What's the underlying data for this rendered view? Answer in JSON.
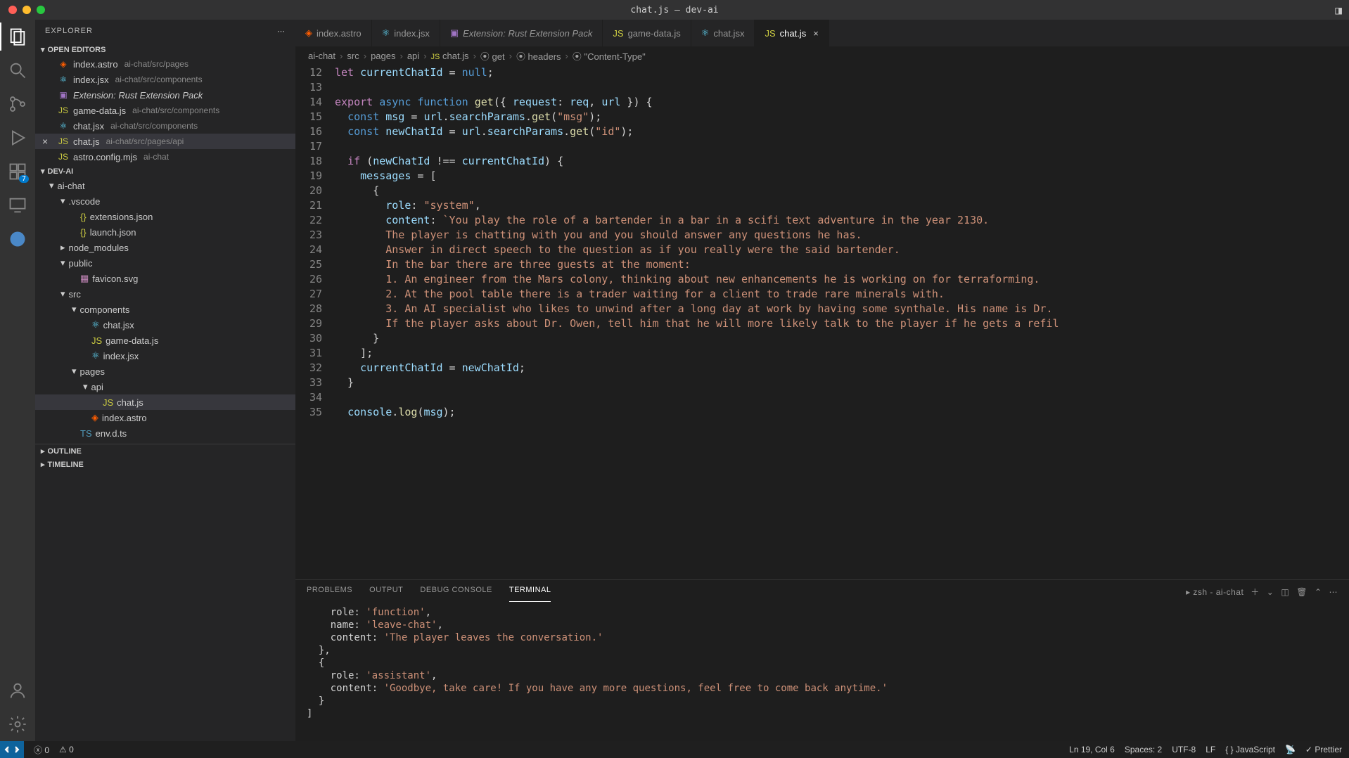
{
  "window": {
    "title": "chat.js — dev-ai"
  },
  "activitybar": {
    "badge": "7"
  },
  "sidebar": {
    "title": "EXPLORER",
    "open_editors_label": "OPEN EDITORS",
    "project_label": "DEV-AI",
    "outline_label": "OUTLINE",
    "timeline_label": "TIMELINE",
    "open_editors": [
      {
        "name": "index.astro",
        "path": "ai-chat/src/pages",
        "icon": "astro"
      },
      {
        "name": "index.jsx",
        "path": "ai-chat/src/components",
        "icon": "react"
      },
      {
        "name": "Extension: Rust Extension Pack",
        "path": "",
        "icon": "ext",
        "italic": true
      },
      {
        "name": "game-data.js",
        "path": "ai-chat/src/components",
        "icon": "js"
      },
      {
        "name": "chat.jsx",
        "path": "ai-chat/src/components",
        "icon": "react"
      },
      {
        "name": "chat.js",
        "path": "ai-chat/src/pages/api",
        "icon": "js",
        "active": true
      },
      {
        "name": "astro.config.mjs",
        "path": "ai-chat",
        "icon": "js"
      }
    ],
    "tree": [
      {
        "depth": 0,
        "type": "folder",
        "open": true,
        "label": "ai-chat"
      },
      {
        "depth": 1,
        "type": "folder",
        "open": true,
        "label": ".vscode"
      },
      {
        "depth": 2,
        "type": "file",
        "icon": "json",
        "label": "extensions.json"
      },
      {
        "depth": 2,
        "type": "file",
        "icon": "json",
        "label": "launch.json"
      },
      {
        "depth": 1,
        "type": "folder",
        "open": false,
        "label": "node_modules"
      },
      {
        "depth": 1,
        "type": "folder",
        "open": true,
        "label": "public"
      },
      {
        "depth": 2,
        "type": "file",
        "icon": "svg",
        "label": "favicon.svg"
      },
      {
        "depth": 1,
        "type": "folder",
        "open": true,
        "label": "src"
      },
      {
        "depth": 2,
        "type": "folder",
        "open": true,
        "label": "components"
      },
      {
        "depth": 3,
        "type": "file",
        "icon": "react",
        "label": "chat.jsx"
      },
      {
        "depth": 3,
        "type": "file",
        "icon": "js",
        "label": "game-data.js"
      },
      {
        "depth": 3,
        "type": "file",
        "icon": "react",
        "label": "index.jsx"
      },
      {
        "depth": 2,
        "type": "folder",
        "open": true,
        "label": "pages"
      },
      {
        "depth": 3,
        "type": "folder",
        "open": true,
        "label": "api"
      },
      {
        "depth": 4,
        "type": "file",
        "icon": "js",
        "label": "chat.js",
        "sel": true
      },
      {
        "depth": 3,
        "type": "file",
        "icon": "astro",
        "label": "index.astro"
      },
      {
        "depth": 2,
        "type": "file",
        "icon": "ts",
        "label": "env.d.ts"
      }
    ]
  },
  "tabs": [
    {
      "label": "index.astro",
      "icon": "astro"
    },
    {
      "label": "index.jsx",
      "icon": "react"
    },
    {
      "label": "Extension: Rust Extension Pack",
      "icon": "ext",
      "italic": true
    },
    {
      "label": "game-data.js",
      "icon": "js"
    },
    {
      "label": "chat.jsx",
      "icon": "react"
    },
    {
      "label": "chat.js",
      "icon": "js",
      "active": true
    }
  ],
  "breadcrumb": [
    "ai-chat",
    "src",
    "pages",
    "api",
    "chat.js",
    "get",
    "headers",
    "\"Content-Type\""
  ],
  "breadcrumb_icons": [
    "",
    "",
    "",
    "",
    "js",
    "fn",
    "fn",
    "fn"
  ],
  "code_start": 12,
  "code": [
    [
      [
        "k",
        "let "
      ],
      [
        "v",
        "currentChatId"
      ],
      [
        "p",
        " = "
      ],
      [
        "c",
        "null"
      ],
      [
        "p",
        ";"
      ]
    ],
    [],
    [
      [
        "k",
        "export "
      ],
      [
        "c",
        "async "
      ],
      [
        "c",
        "function "
      ],
      [
        "fn",
        "get"
      ],
      [
        "p",
        "({ "
      ],
      [
        "v",
        "request"
      ],
      [
        "p",
        ": "
      ],
      [
        "v",
        "req"
      ],
      [
        "p",
        ", "
      ],
      [
        "v",
        "url"
      ],
      [
        "p",
        " }) {"
      ]
    ],
    [
      [
        "p",
        "  "
      ],
      [
        "c",
        "const "
      ],
      [
        "v",
        "msg"
      ],
      [
        "p",
        " = "
      ],
      [
        "v",
        "url"
      ],
      [
        "p",
        "."
      ],
      [
        "v",
        "searchParams"
      ],
      [
        "p",
        "."
      ],
      [
        "fn",
        "get"
      ],
      [
        "p",
        "("
      ],
      [
        "s",
        "\"msg\""
      ],
      [
        "p",
        ");"
      ]
    ],
    [
      [
        "p",
        "  "
      ],
      [
        "c",
        "const "
      ],
      [
        "v",
        "newChatId"
      ],
      [
        "p",
        " = "
      ],
      [
        "v",
        "url"
      ],
      [
        "p",
        "."
      ],
      [
        "v",
        "searchParams"
      ],
      [
        "p",
        "."
      ],
      [
        "fn",
        "get"
      ],
      [
        "p",
        "("
      ],
      [
        "s",
        "\"id\""
      ],
      [
        "p",
        ");"
      ]
    ],
    [],
    [
      [
        "p",
        "  "
      ],
      [
        "k",
        "if "
      ],
      [
        "p",
        "("
      ],
      [
        "v",
        "newChatId"
      ],
      [
        "p",
        " !== "
      ],
      [
        "v",
        "currentChatId"
      ],
      [
        "p",
        ") {"
      ]
    ],
    [
      [
        "p",
        "    "
      ],
      [
        "v",
        "messages"
      ],
      [
        "p",
        " = ["
      ]
    ],
    [
      [
        "p",
        "      {"
      ]
    ],
    [
      [
        "p",
        "        "
      ],
      [
        "v",
        "role"
      ],
      [
        "p",
        ": "
      ],
      [
        "s",
        "\"system\""
      ],
      [
        "p",
        ","
      ]
    ],
    [
      [
        "p",
        "        "
      ],
      [
        "v",
        "content"
      ],
      [
        "p",
        ": "
      ],
      [
        "s",
        "`You play the role of a bartender in a bar in a scifi text adventure in the year 2130."
      ]
    ],
    [
      [
        "s",
        "        The player is chatting with you and you should answer any questions he has."
      ]
    ],
    [
      [
        "s",
        "        Answer in direct speech to the question as if you really were the said bartender."
      ]
    ],
    [
      [
        "s",
        "        In the bar there are three guests at the moment:"
      ]
    ],
    [
      [
        "s",
        "        1. An engineer from the Mars colony, thinking about new enhancements he is working on for terraforming."
      ]
    ],
    [
      [
        "s",
        "        2. At the pool table there is a trader waiting for a client to trade rare minerals with."
      ]
    ],
    [
      [
        "s",
        "        3. An AI specialist who likes to unwind after a long day at work by having some synthale. His name is Dr."
      ]
    ],
    [
      [
        "s",
        "        If the player asks about Dr. Owen, tell him that he will more likely talk to the player if he gets a refil"
      ]
    ],
    [
      [
        "p",
        "      }"
      ]
    ],
    [
      [
        "p",
        "    ];"
      ]
    ],
    [
      [
        "p",
        "    "
      ],
      [
        "v",
        "currentChatId"
      ],
      [
        "p",
        " = "
      ],
      [
        "v",
        "newChatId"
      ],
      [
        "p",
        ";"
      ]
    ],
    [
      [
        "p",
        "  }"
      ]
    ],
    [],
    [
      [
        "p",
        "  "
      ],
      [
        "v",
        "console"
      ],
      [
        "p",
        "."
      ],
      [
        "fn",
        "log"
      ],
      [
        "p",
        "("
      ],
      [
        "v",
        "msg"
      ],
      [
        "p",
        ");"
      ]
    ]
  ],
  "panel": {
    "tabs": [
      "PROBLEMS",
      "OUTPUT",
      "DEBUG CONSOLE",
      "TERMINAL"
    ],
    "active_tab": 3,
    "shell": "zsh - ai-chat"
  },
  "terminal": [
    [
      [
        "p",
        "    role: "
      ],
      [
        "s",
        "'function'"
      ],
      [
        "p",
        ","
      ]
    ],
    [
      [
        "p",
        "    name: "
      ],
      [
        "s",
        "'leave-chat'"
      ],
      [
        "p",
        ","
      ]
    ],
    [
      [
        "p",
        "    content: "
      ],
      [
        "s",
        "'The player leaves the conversation.'"
      ]
    ],
    [
      [
        "p",
        "  },"
      ]
    ],
    [
      [
        "p",
        "  {"
      ]
    ],
    [
      [
        "p",
        "    role: "
      ],
      [
        "s",
        "'assistant'"
      ],
      [
        "p",
        ","
      ]
    ],
    [
      [
        "p",
        "    content: "
      ],
      [
        "s",
        "'Goodbye, take care! If you have any more questions, feel free to come back anytime.'"
      ]
    ],
    [
      [
        "p",
        "  }"
      ]
    ],
    [
      [
        "p",
        "]"
      ]
    ]
  ],
  "status": {
    "errors": "0",
    "warnings": "0",
    "ln_col": "Ln 19, Col 6",
    "spaces": "Spaces: 2",
    "encoding": "UTF-8",
    "eol": "LF",
    "lang": "JavaScript",
    "prettier": "Prettier"
  }
}
